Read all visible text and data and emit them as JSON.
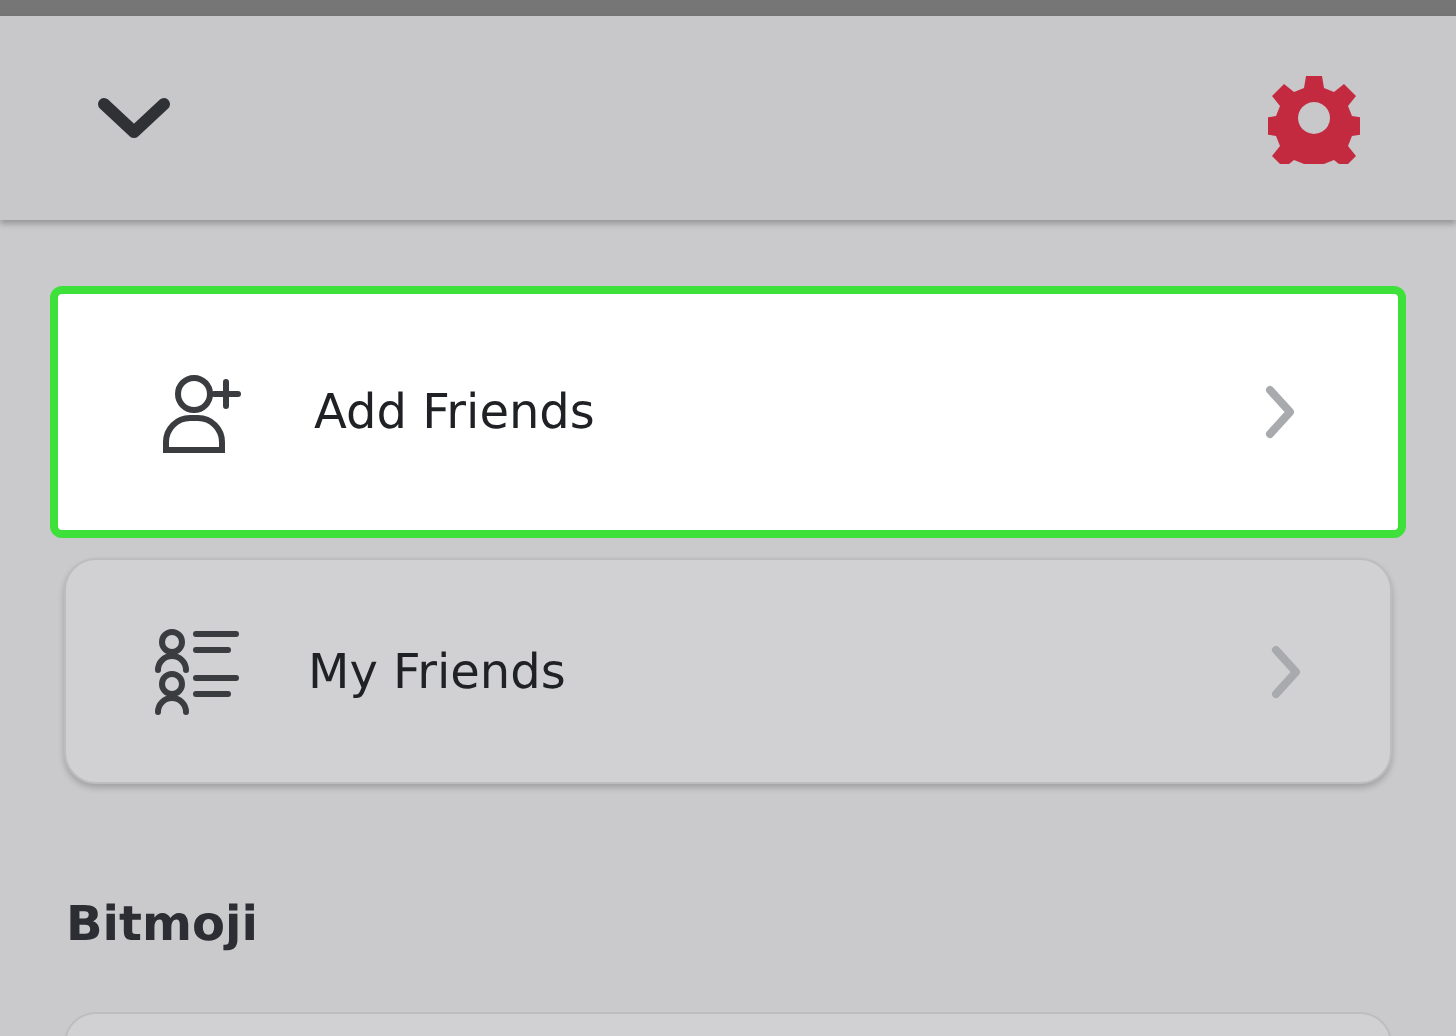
{
  "items": [
    {
      "kind": "add-friend",
      "label": "Add Friends",
      "selected": true
    },
    {
      "kind": "friend-list",
      "label": "My Friends",
      "selected": false
    }
  ],
  "section": {
    "title": "Bitmoji"
  }
}
